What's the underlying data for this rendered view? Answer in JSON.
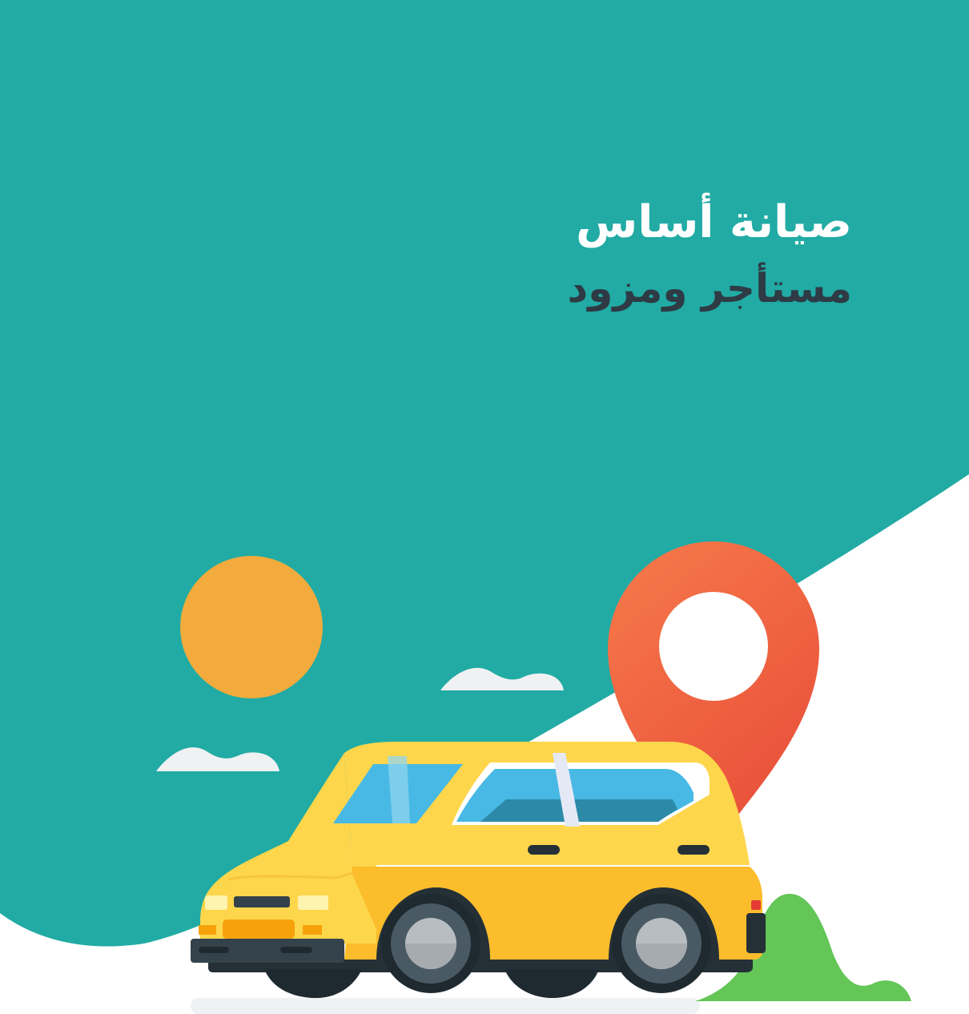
{
  "splash": {
    "title": "صيانة أساس",
    "subtitle": "مستأجر ومزود"
  },
  "colors": {
    "background_teal": "#21aba4",
    "background_white": "#ffffff",
    "sun": "#f2ab3c",
    "pin": "#f0623f",
    "car_body": "#fdd64c",
    "car_window": "#47b9e4",
    "bush": "#63c657",
    "cloud": "#eff1f2",
    "subtitle_text": "#2e3b44"
  },
  "illustration": {
    "icons": [
      "sun-icon",
      "cloud-icon",
      "location-pin-icon",
      "car-icon",
      "bush-icon"
    ]
  }
}
